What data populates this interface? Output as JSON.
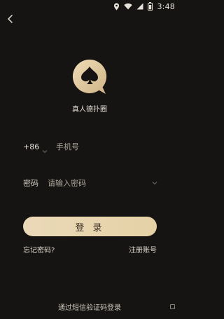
{
  "status_bar": {
    "time": "3:48",
    "icons": [
      "location-icon",
      "wifi-icon",
      "signal-icon",
      "battery-icon"
    ]
  },
  "header": {
    "back_icon": "back-arrow-icon"
  },
  "app": {
    "name": "真人德扑圈",
    "logo_icon": "spade-chat-bubble-logo",
    "accent": "#e8d5b0",
    "background": "#161412"
  },
  "form": {
    "country_code": "+86",
    "phone_placeholder": "手机号",
    "password_label": "密码",
    "password_placeholder": "请输入密码",
    "login_button": "登 录"
  },
  "links": {
    "forgot_password": "忘记密码?",
    "register": "注册账号",
    "sms_login": "通过短信验证码登录"
  }
}
